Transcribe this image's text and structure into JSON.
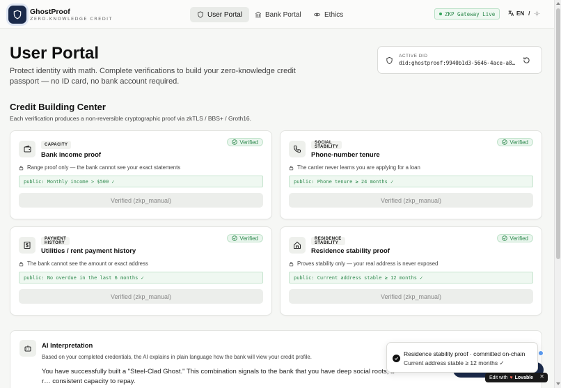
{
  "brand": {
    "name": "GhostProof",
    "tagline": "ZERO-KNOWLEDGE CREDIT"
  },
  "nav": [
    {
      "label": "User Portal",
      "active": true,
      "icon": "shield-icon"
    },
    {
      "label": "Bank Portal",
      "active": false,
      "icon": "bank-icon"
    },
    {
      "label": "Ethics",
      "active": false,
      "icon": "eye-icon"
    }
  ],
  "gateway": {
    "label": "ZKP Gateway Live",
    "color": "#2f8a4e"
  },
  "language": {
    "code": "EN",
    "separator": "/"
  },
  "page": {
    "title": "User Portal",
    "description": "Protect identity with math. Complete verifications to build your zero-knowledge credit passport — no ID card, no bank account required."
  },
  "did": {
    "label": "ACTIVE DID",
    "value": "did:ghostproof:9940b1d3-5646-4ace-a8…"
  },
  "section": {
    "title": "Credit Building Center",
    "description": "Each verification produces a non-reversible cryptographic proof via zkTLS / BBS+ / Groth16."
  },
  "cards": [
    {
      "tag": "CAPACITY",
      "name": "Bank income proof",
      "badge": "Verified",
      "note": "Range proof only — the bank cannot see your exact statements",
      "claim": "public: Monthly income > $500 ✓",
      "button": "Verified (zkp_manual)",
      "icon": "wallet-icon"
    },
    {
      "tag": "SOCIAL STABILITY",
      "name": "Phone-number tenure",
      "badge": "Verified",
      "note": "The carrier never learns you are applying for a loan",
      "claim": "public: Phone tenure ≥ 24 months ✓",
      "button": "Verified (zkp_manual)",
      "icon": "phone-icon"
    },
    {
      "tag": "PAYMENT HISTORY",
      "name": "Utilities / rent payment history",
      "badge": "Verified",
      "note": "The bank cannot see the amount or exact address",
      "claim": "public: No overdue in the last 6 months ✓",
      "button": "Verified (zkp_manual)",
      "icon": "receipt-icon"
    },
    {
      "tag": "RESIDENCE STABILITY",
      "name": "Residence stability proof",
      "badge": "Verified",
      "note": "Proves stability only — your real address is never exposed",
      "claim": "public: Current address stable ≥ 12 months ✓",
      "button": "Verified (zkp_manual)",
      "icon": "home-icon"
    }
  ],
  "ai": {
    "title": "AI Interpretation",
    "description": "Based on your completed credentials, the AI explains in plain language how the bank will view your credit profile.",
    "body": "You have successfully built a \"Steel-Clad Ghost.\" This combination signals to the bank that you have deep social roots, a r… consistent capacity to repay."
  },
  "toast": {
    "title": "Residence stability proof · committed on-chain",
    "subtitle": "Current address stable ≥ 12 months ✓"
  },
  "lovable": {
    "label": "Edit with",
    "brand": "Lovable",
    "close": "✕"
  }
}
